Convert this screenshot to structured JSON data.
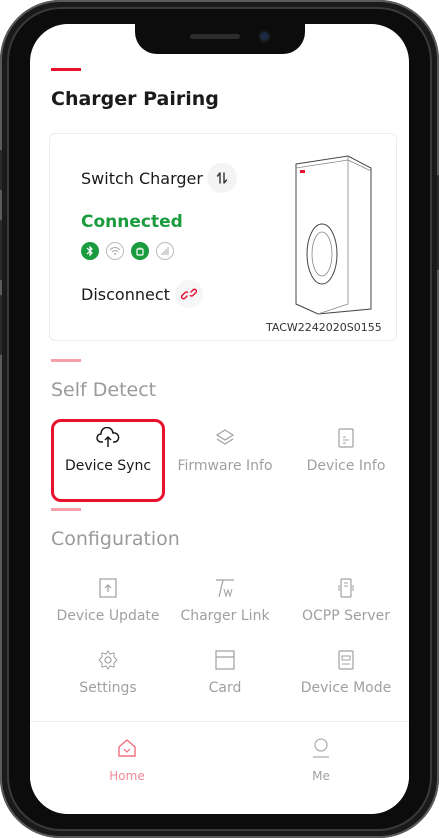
{
  "header": {
    "title": "Charger Pairing"
  },
  "pairing_card": {
    "switch_label": "Switch Charger",
    "status": "Connected",
    "status_icons": [
      {
        "icon": "bluetooth-icon",
        "active": true
      },
      {
        "icon": "wifi-icon",
        "active": false
      },
      {
        "icon": "cellular-icon",
        "active": true
      },
      {
        "icon": "signal-icon",
        "active": false
      }
    ],
    "disconnect_label": "Disconnect",
    "serial": "TACW2242020S0155"
  },
  "self_detect": {
    "title": "Self Detect",
    "items": [
      {
        "label": "Device Sync",
        "icon": "cloud-upload-icon",
        "selected": true
      },
      {
        "label": "Firmware Info",
        "icon": "layers-icon"
      },
      {
        "label": "Device Info",
        "icon": "document-icon"
      }
    ]
  },
  "configuration": {
    "title": "Configuration",
    "items": [
      {
        "label": "Device Update",
        "icon": "update-icon"
      },
      {
        "label": "Charger Link",
        "icon": "charger-link-icon"
      },
      {
        "label": "OCPP Server",
        "icon": "server-icon"
      },
      {
        "label": "Settings",
        "icon": "gear-icon"
      },
      {
        "label": "Card",
        "icon": "card-icon"
      },
      {
        "label": "Device Mode",
        "icon": "device-mode-icon"
      }
    ]
  },
  "tabbar": {
    "tabs": [
      {
        "label": "Home",
        "icon": "home-icon",
        "active": true
      },
      {
        "label": "Me",
        "icon": "user-icon",
        "active": false
      }
    ]
  },
  "colors": {
    "accent": "#e8112d",
    "connected": "#1a9c3e",
    "muted": "#a0a0a0"
  }
}
